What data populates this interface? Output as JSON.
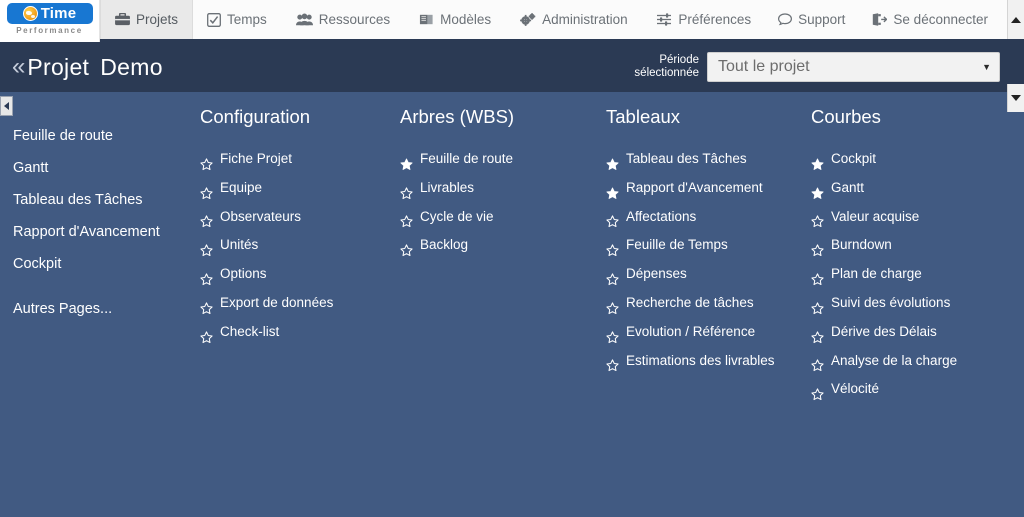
{
  "brand": {
    "name": "Time",
    "tagline": "Performance",
    "logo_icon": "globe-icon",
    "pill_color": "#1877d2",
    "globe_color": "#f5a623"
  },
  "topnav": {
    "left_items": [
      {
        "label": "Projets",
        "icon": "briefcase-icon",
        "active": true
      },
      {
        "label": "Temps",
        "icon": "checked-square-icon",
        "active": false
      },
      {
        "label": "Ressources",
        "icon": "users-icon",
        "active": false
      },
      {
        "label": "Modèles",
        "icon": "book-icon",
        "active": false
      },
      {
        "label": "Administration",
        "icon": "gears-icon",
        "active": false
      }
    ],
    "right_items": [
      {
        "label": "Préférences",
        "icon": "sliders-icon"
      },
      {
        "label": "Support",
        "icon": "comment-icon"
      },
      {
        "label": "Se déconnecter",
        "icon": "logout-icon"
      }
    ]
  },
  "project_header": {
    "back_glyph": "«",
    "title": "Projet",
    "project_name": "Demo",
    "period_label": "Période\nsélectionnée",
    "period_value": "Tout le projet",
    "caret_glyph": "▼",
    "background": "#2b3a54"
  },
  "sidebar": {
    "collapse_icon": "chevron-left-icon",
    "items": [
      {
        "label": "Feuille de route"
      },
      {
        "label": "Gantt"
      },
      {
        "label": "Tableau des Tâches"
      },
      {
        "label": "Rapport d'Avancement"
      },
      {
        "label": "Cockpit"
      },
      {
        "label": "Autres Pages..."
      }
    ]
  },
  "columns": [
    {
      "title": "Configuration",
      "links": [
        {
          "label": "Fiche Projet",
          "starred": false
        },
        {
          "label": "Equipe",
          "starred": false
        },
        {
          "label": "Observateurs",
          "starred": false
        },
        {
          "label": "Unités",
          "starred": false
        },
        {
          "label": "Options",
          "starred": false
        },
        {
          "label": "Export de données",
          "starred": false
        },
        {
          "label": "Check-list",
          "starred": false
        }
      ]
    },
    {
      "title": "Arbres (WBS)",
      "links": [
        {
          "label": "Feuille de route",
          "starred": true
        },
        {
          "label": "Livrables",
          "starred": false
        },
        {
          "label": "Cycle de vie",
          "starred": false
        },
        {
          "label": "Backlog",
          "starred": false
        }
      ]
    },
    {
      "title": "Tableaux",
      "links": [
        {
          "label": "Tableau des Tâches",
          "starred": true
        },
        {
          "label": "Rapport d'Avancement",
          "starred": true
        },
        {
          "label": "Affectations",
          "starred": false
        },
        {
          "label": "Feuille de Temps",
          "starred": false
        },
        {
          "label": "Dépenses",
          "starred": false
        },
        {
          "label": "Recherche de tâches",
          "starred": false
        },
        {
          "label": "Evolution / Référence",
          "starred": false
        },
        {
          "label": "Estimations des livrables",
          "starred": false
        }
      ]
    },
    {
      "title": "Courbes",
      "links": [
        {
          "label": "Cockpit",
          "starred": true
        },
        {
          "label": "Gantt",
          "starred": true
        },
        {
          "label": "Valeur acquise",
          "starred": false
        },
        {
          "label": "Burndown",
          "starred": false
        },
        {
          "label": "Plan de charge",
          "starred": false
        },
        {
          "label": "Suivi des évolutions",
          "starred": false
        },
        {
          "label": "Dérive des Délais",
          "starred": false
        },
        {
          "label": "Analyse de la charge",
          "starred": false
        },
        {
          "label": "Vélocité",
          "starred": false
        }
      ]
    }
  ],
  "theme": {
    "page_background": "#415a82",
    "header_background": "#2b3a54",
    "topnav_background": "#fbfbfb",
    "text_on_dark": "#ffffff"
  }
}
